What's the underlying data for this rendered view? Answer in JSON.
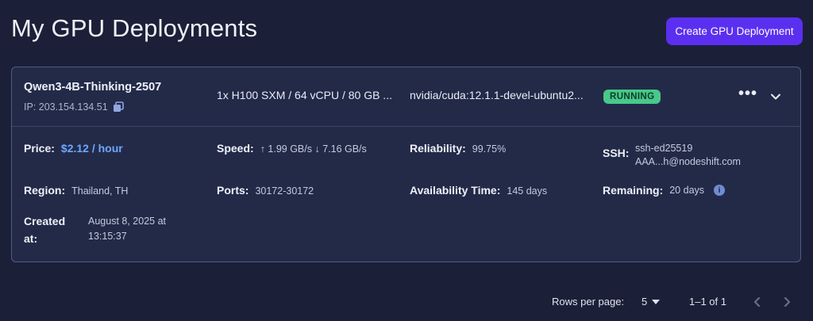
{
  "page": {
    "title": "My GPU Deployments"
  },
  "header": {
    "create_button": "Create GPU Deployment"
  },
  "deployment": {
    "name": "Qwen3-4B-Thinking-2507",
    "ip": "IP: 203.154.134.51",
    "spec": "1x H100 SXM / 64 vCPU / 80 GB ...",
    "image": "nvidia/cuda:12.1.1-devel-ubuntu2...",
    "status": "RUNNING",
    "menu_icon": "more-horizontal-icon",
    "expand_icon": "chevron-down-icon",
    "details": {
      "price_label": "Price:",
      "price_value": "$2.12 / hour",
      "speed_label": "Speed:",
      "speed_value": "↑ 1.99 GB/s ↓ 7.16 GB/s",
      "reliability_label": "Reliability:",
      "reliability_value": "99.75%",
      "ssh_label": "SSH:",
      "ssh_line1": "ssh-ed25519",
      "ssh_line2": "AAA...h@nodeshift.com",
      "region_label": "Region:",
      "region_value": "Thailand, TH",
      "ports_label": "Ports:",
      "ports_value": "30172-30172",
      "availability_label": "Availability Time:",
      "availability_value": "145 days",
      "remaining_label": "Remaining:",
      "remaining_value": "20 days",
      "created_label_1": "Created",
      "created_label_2": "at:",
      "created_value_1": "August 8, 2025 at",
      "created_value_2": "13:15:37"
    }
  },
  "pagination": {
    "rows_per_page_label": "Rows per page:",
    "rows_per_page_value": "5",
    "range": "1–1 of 1"
  },
  "colors": {
    "background": "#1b2038",
    "accent": "#5b2ff0",
    "status_running": "#47c98a",
    "price": "#6ea8ff"
  }
}
